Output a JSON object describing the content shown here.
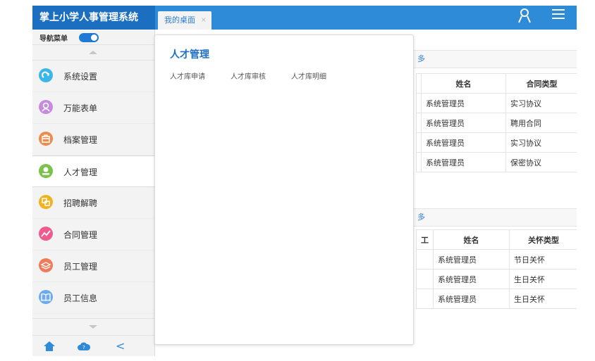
{
  "app": {
    "title": "掌上小学人事管理系统"
  },
  "tabs": [
    {
      "label": "我的桌面",
      "close": "×"
    }
  ],
  "sidebar": {
    "nav_toggle_label": "导航菜单",
    "items": [
      {
        "label": "系统设置",
        "icon": "settings-icon",
        "color": "#3bb6e8"
      },
      {
        "label": "万能表单",
        "icon": "user-icon",
        "color": "#c48be0"
      },
      {
        "label": "档案管理",
        "icon": "briefcase-icon",
        "color": "#f08a4b"
      },
      {
        "label": "人才管理",
        "icon": "talent-icon",
        "color": "#7cc24a",
        "active": true
      },
      {
        "label": "招聘解聘",
        "icon": "recruit-icon",
        "color": "#f2b21e"
      },
      {
        "label": "合同管理",
        "icon": "chart-icon",
        "color": "#f05b8f"
      },
      {
        "label": "员工管理",
        "icon": "layers-icon",
        "color": "#f07a59"
      },
      {
        "label": "员工信息",
        "icon": "book-icon",
        "color": "#6ca9ef"
      }
    ],
    "back_glyph": "<"
  },
  "popup": {
    "title": "人才管理",
    "links": [
      "人才库申请",
      "人才库审核",
      "人才库明细"
    ]
  },
  "panel1": {
    "more_fragment": "多",
    "headers": [
      "姓名",
      "合同类型"
    ],
    "rows": [
      [
        "系统管理员",
        "实习协议"
      ],
      [
        "系统管理员",
        "聘用合同"
      ],
      [
        "系统管理员",
        "实习协议"
      ],
      [
        "系统管理员",
        "保密协议"
      ]
    ]
  },
  "panel2": {
    "more_fragment": "多",
    "header_fragment": "工",
    "headers": [
      "姓名",
      "关怀类型"
    ],
    "rows": [
      [
        "系统管理员",
        "节日关怀"
      ],
      [
        "系统管理员",
        "生日关怀"
      ],
      [
        "系统管理员",
        "生日关怀"
      ]
    ]
  },
  "colors": {
    "topbar": "#2e8bd8",
    "brand": "#1c6fc0",
    "accent": "#2e7fd1"
  }
}
